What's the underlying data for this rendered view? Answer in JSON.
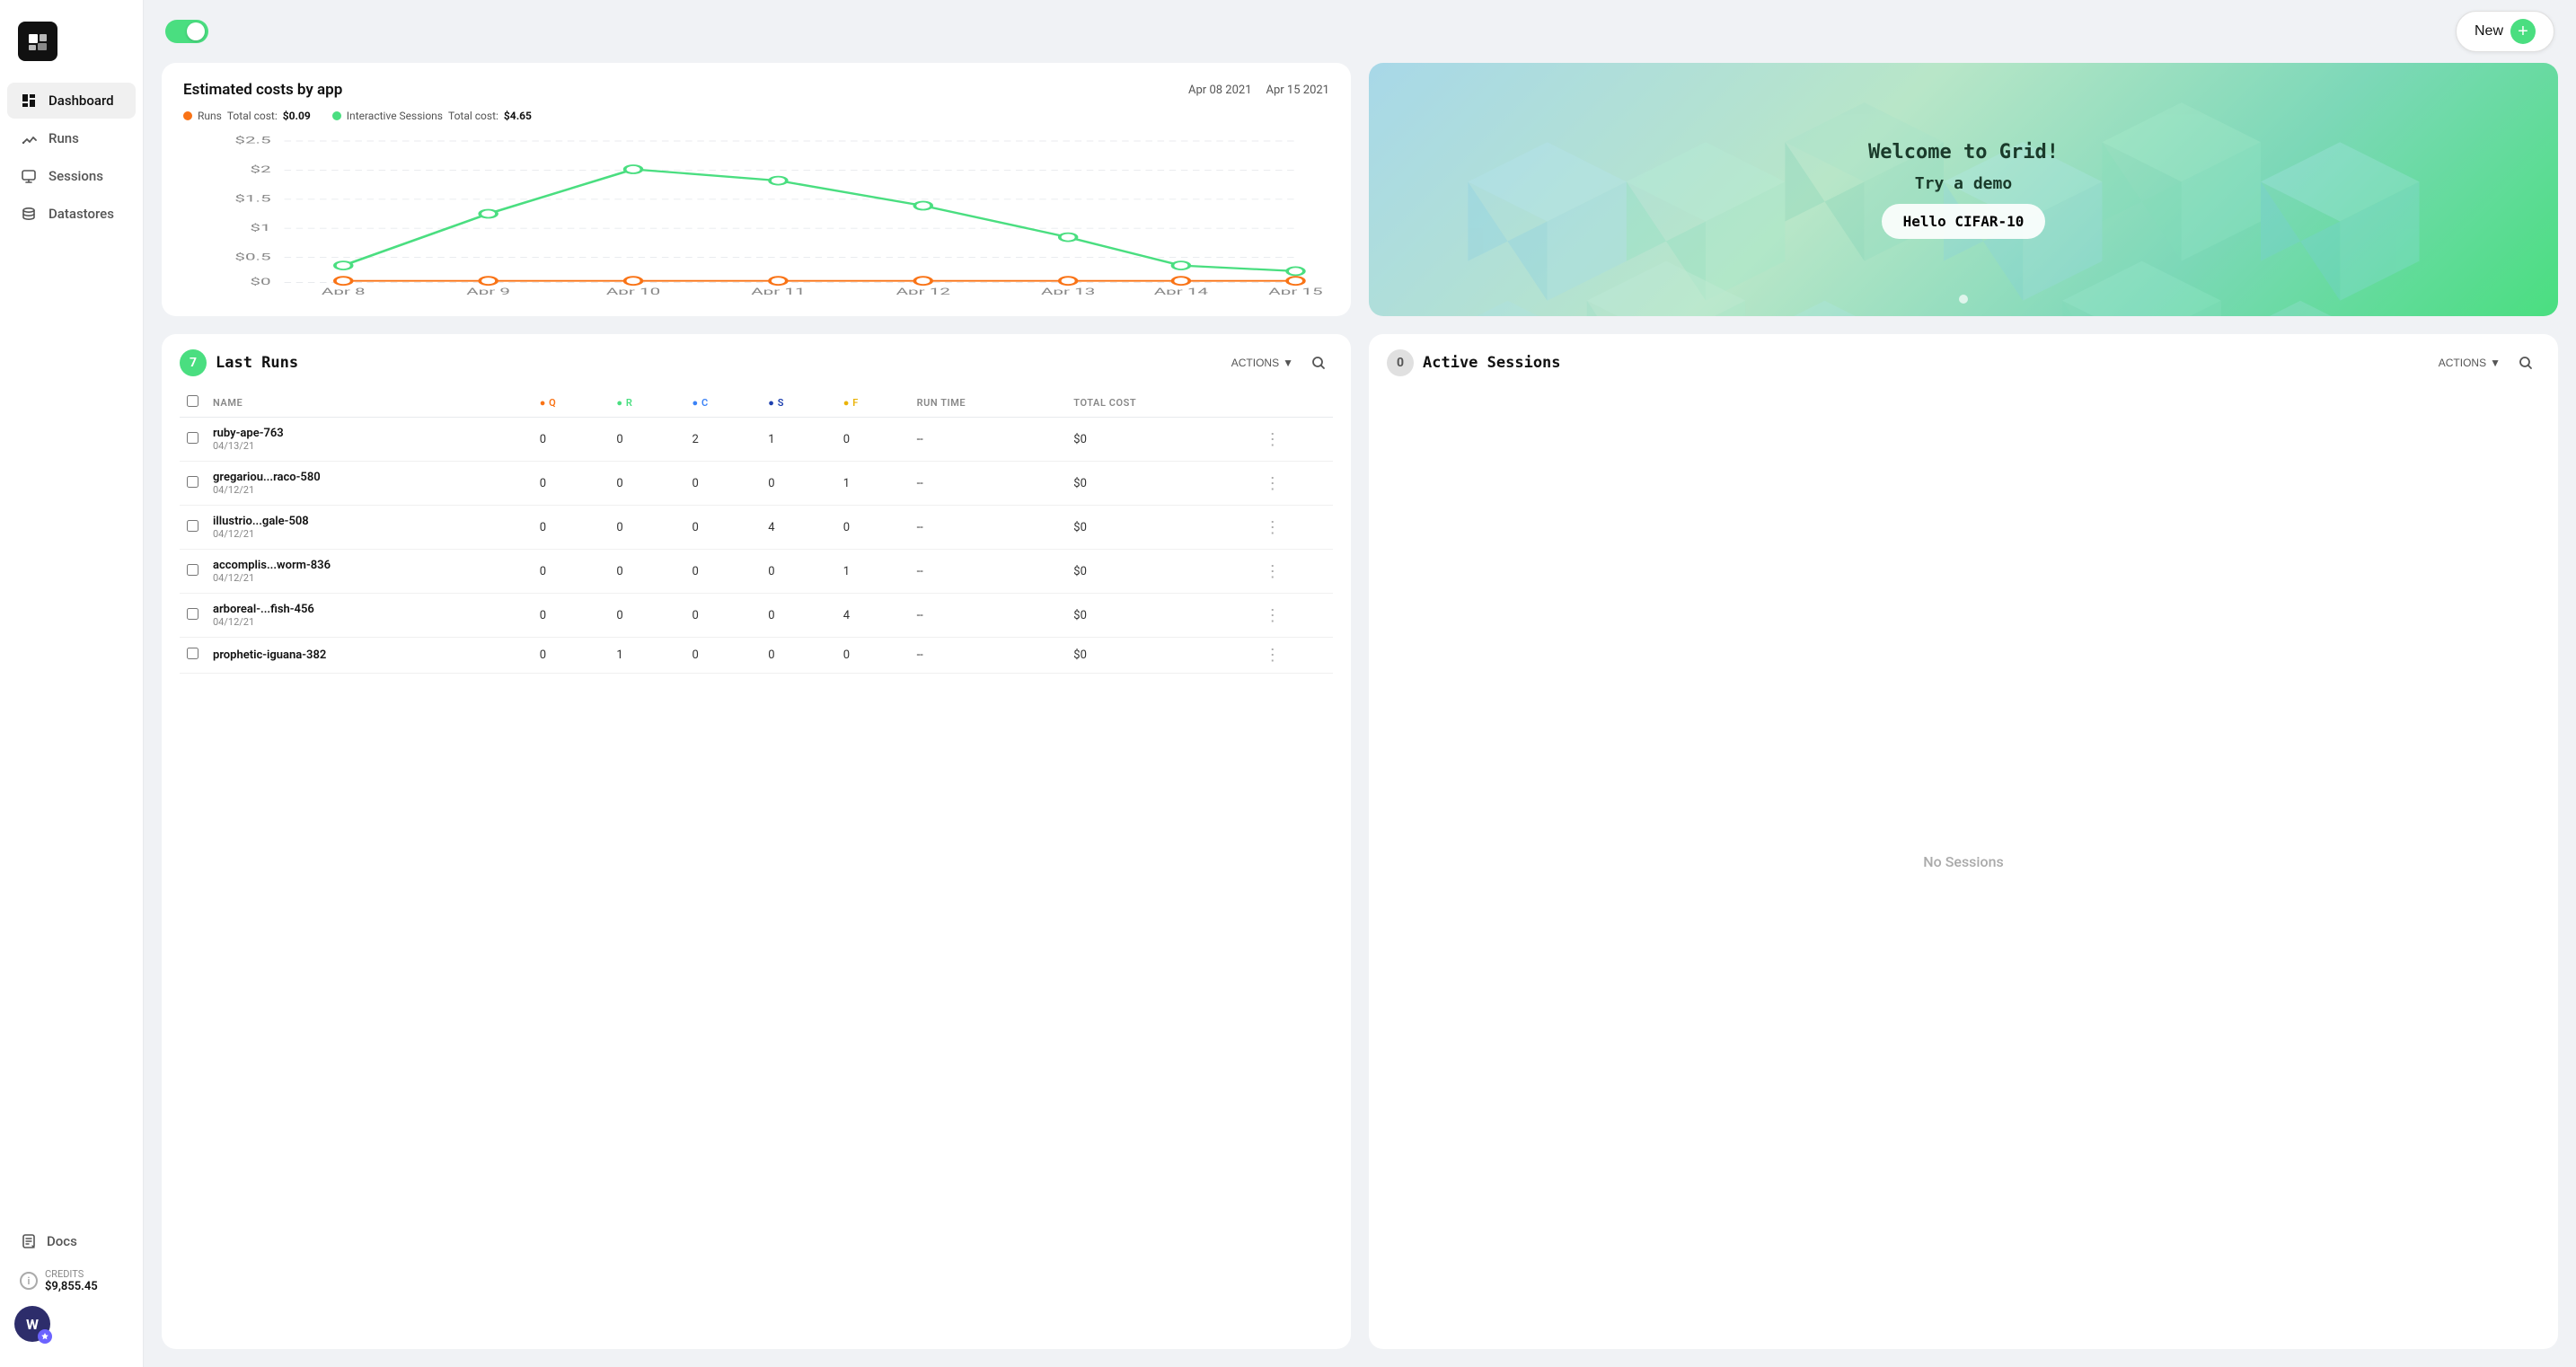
{
  "app": {
    "logo_text": "G",
    "new_button_label": "New"
  },
  "sidebar": {
    "nav_items": [
      {
        "id": "dashboard",
        "label": "Dashboard",
        "active": true
      },
      {
        "id": "runs",
        "label": "Runs",
        "active": false
      },
      {
        "id": "sessions",
        "label": "Sessions",
        "active": false
      },
      {
        "id": "datastores",
        "label": "Datastores",
        "active": false
      }
    ],
    "docs_label": "Docs",
    "credits_label": "CREDITS",
    "credits_amount": "$9,855.45",
    "user_initial": "W"
  },
  "chart": {
    "title": "Estimated costs by app",
    "date_start": "Apr 08 2021",
    "date_end": "Apr 15 2021",
    "legend": [
      {
        "id": "runs",
        "label": "Runs",
        "color": "#f97316",
        "cost_label": "Total cost:",
        "cost": "$0.09"
      },
      {
        "id": "sessions",
        "label": "Interactive Sessions",
        "color": "#4ade80",
        "cost_label": "Total cost:",
        "cost": "$4.65"
      }
    ],
    "x_labels": [
      "Apr 8",
      "Apr 9",
      "Apr 10",
      "Apr 11",
      "Apr 12",
      "Apr 13",
      "Apr 14",
      "Apr 15"
    ],
    "y_labels": [
      "$2.5",
      "$2",
      "$1.5",
      "$1",
      "$0.5",
      "$0"
    ],
    "runs_data": [
      0,
      0,
      0,
      0,
      0,
      0,
      0,
      0
    ],
    "sessions_data": [
      0.3,
      1.4,
      2.0,
      1.8,
      1.4,
      0.8,
      0.2,
      0.2
    ]
  },
  "welcome": {
    "title": "Welcome to Grid!",
    "subtitle": "Try a demo",
    "button_label": "Hello CIFAR-10"
  },
  "last_runs": {
    "title": "Last Runs",
    "count": "7",
    "actions_label": "ACTIONS",
    "columns": [
      "NAME",
      "Q",
      "R",
      "C",
      "S",
      "F",
      "RUN TIME",
      "TOTAL COST"
    ],
    "rows": [
      {
        "name": "ruby-ape-763",
        "date": "04/13/21",
        "q": "0",
        "r": "0",
        "c": "2",
        "s": "1",
        "f": "0",
        "run_time": "--",
        "total_cost": "$0"
      },
      {
        "name": "gregariou...raco-580",
        "date": "04/12/21",
        "q": "0",
        "r": "0",
        "c": "0",
        "s": "0",
        "f": "1",
        "run_time": "--",
        "total_cost": "$0"
      },
      {
        "name": "illustrio...gale-508",
        "date": "04/12/21",
        "q": "0",
        "r": "0",
        "c": "0",
        "s": "4",
        "f": "0",
        "run_time": "--",
        "total_cost": "$0"
      },
      {
        "name": "accomplis...worm-836",
        "date": "04/12/21",
        "q": "0",
        "r": "0",
        "c": "0",
        "s": "0",
        "f": "1",
        "run_time": "--",
        "total_cost": "$0"
      },
      {
        "name": "arboreal-...fish-456",
        "date": "04/12/21",
        "q": "0",
        "r": "0",
        "c": "0",
        "s": "0",
        "f": "4",
        "run_time": "--",
        "total_cost": "$0"
      },
      {
        "name": "prophetic-iguana-382",
        "date": "",
        "q": "0",
        "r": "1",
        "c": "0",
        "s": "0",
        "f": "0",
        "run_time": "--",
        "total_cost": "$0"
      }
    ]
  },
  "active_sessions": {
    "title": "Active Sessions",
    "count": "0",
    "actions_label": "ACTIONS",
    "empty_label": "No Sessions"
  },
  "colors": {
    "green": "#4ade80",
    "orange": "#f97316",
    "blue": "#3b82f6",
    "navy": "#1e40af",
    "yellow": "#eab308"
  }
}
